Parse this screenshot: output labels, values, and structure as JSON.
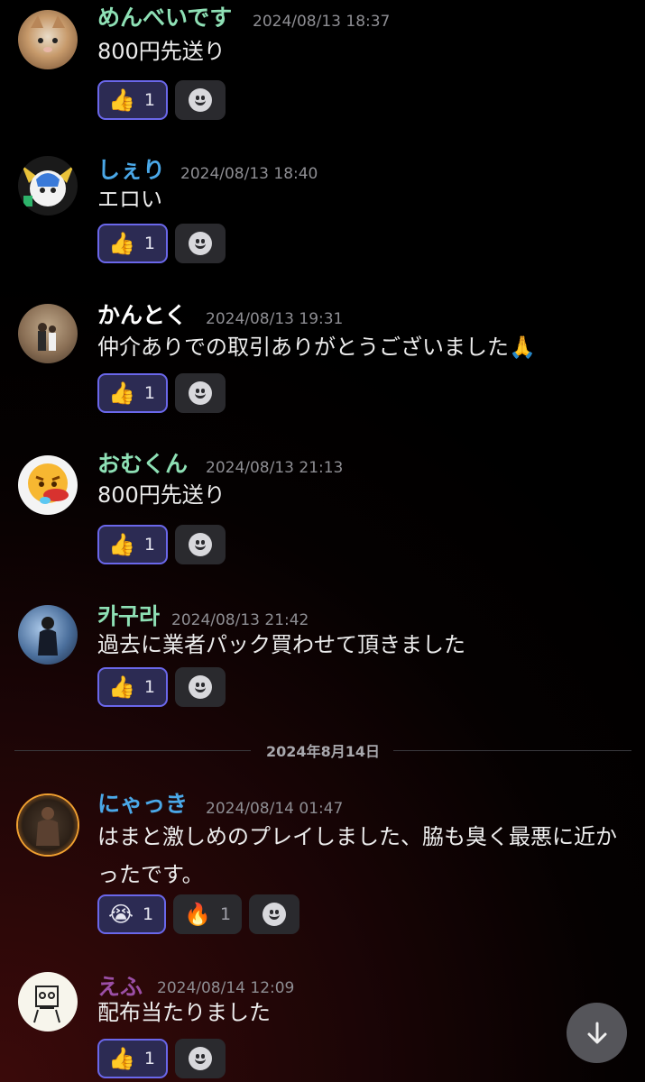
{
  "colors": {
    "accent": "#6a67ea",
    "name_green": "#8ee0b5",
    "name_blue": "#4aa8e8",
    "name_white": "#ffffff",
    "name_purple": "#9b4fa6",
    "timestamp": "#8e8e93"
  },
  "messages": [
    {
      "author": "めんべいです",
      "timestamp": "2024/08/13 18:37",
      "text": "800円先送り",
      "reactions": [
        {
          "emoji": "👍",
          "count": "1",
          "mine": true
        }
      ]
    },
    {
      "author": "しぇり",
      "timestamp": "2024/08/13 18:40",
      "text": "エロい",
      "reactions": [
        {
          "emoji": "👍",
          "count": "1",
          "mine": true
        }
      ]
    },
    {
      "author": "かんとく",
      "timestamp": "2024/08/13 19:31",
      "text": "仲介ありでの取引ありがとうございました🙏",
      "reactions": [
        {
          "emoji": "👍",
          "count": "1",
          "mine": true
        }
      ]
    },
    {
      "author": "おむくん",
      "timestamp": "2024/08/13 21:13",
      "text": "800円先送り",
      "reactions": [
        {
          "emoji": "👍",
          "count": "1",
          "mine": true
        }
      ]
    },
    {
      "author": "카구라",
      "timestamp": "2024/08/13 21:42",
      "text": "過去に業者パック買わせて頂きました",
      "reactions": [
        {
          "emoji": "👍",
          "count": "1",
          "mine": true
        }
      ]
    },
    {
      "author": "にゃっき",
      "timestamp": "2024/08/14 01:47",
      "text": "はまと激しめのプレイしました、脇も臭く最悪に近かったです。",
      "reactions": [
        {
          "emoji": "😭",
          "count": "1",
          "mine": true
        },
        {
          "emoji": "🔥",
          "count": "1",
          "mine": false
        }
      ]
    },
    {
      "author": "えふ",
      "timestamp": "2024/08/14 12:09",
      "text": "配布当たりました",
      "reactions": [
        {
          "emoji": "👍",
          "count": "1",
          "mine": true
        }
      ]
    }
  ],
  "date_divider": "2024年8月14日",
  "icons": {
    "add_reaction": "smiley-add-reaction-icon",
    "scroll_down": "arrow-down-icon"
  }
}
